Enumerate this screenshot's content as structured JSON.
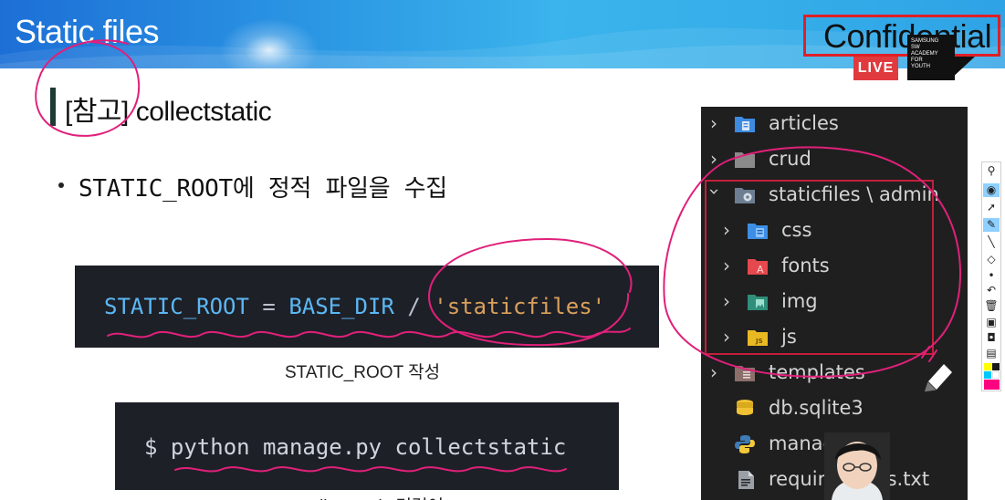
{
  "slide": {
    "title": "Static files",
    "confidential_label": "Confidential",
    "live_badge": "LIVE",
    "logo_text": "SAMSUNG\nSW\nACADEMY\nFOR\nYOUTH",
    "heading": "[참고] collectstatic",
    "bullet": "STATIC_ROOT에 정적 파일을 수집"
  },
  "code_blocks": [
    {
      "tokens": {
        "var1": "STATIC_ROOT",
        "eq": " = ",
        "var2": "BASE_DIR",
        "slash": " / ",
        "str": "'staticfiles'"
      },
      "caption": "STATIC_ROOT 작성"
    },
    {
      "line": "$ python manage.py collectstatic",
      "caption": "collectstatic 명령어"
    }
  ],
  "explorer": {
    "items": [
      {
        "label": "articles",
        "icon": "folder-blue-icon",
        "expanded": false
      },
      {
        "label": "crud",
        "icon": "folder-icon",
        "expanded": false
      },
      {
        "label": "staticfiles \\ admin",
        "icon": "folder-gear-icon",
        "expanded": true
      },
      {
        "label": "css",
        "icon": "folder-css-icon",
        "expanded": false
      },
      {
        "label": "fonts",
        "icon": "folder-fonts-icon",
        "expanded": false
      },
      {
        "label": "img",
        "icon": "folder-img-icon",
        "expanded": false
      },
      {
        "label": "js",
        "icon": "folder-js-icon",
        "expanded": false
      },
      {
        "label": "templates",
        "icon": "folder-templates-icon",
        "expanded": false
      },
      {
        "label": "db.sqlite3",
        "icon": "database-icon"
      },
      {
        "label": "manage.py",
        "icon": "python-icon"
      },
      {
        "label": "requirements.txt",
        "icon": "text-file-icon"
      }
    ]
  },
  "toolbar": {
    "tools": [
      "pin-icon",
      "eye-icon",
      "cursor-icon",
      "pen-icon",
      "line-icon",
      "eraser-icon",
      "dot-icon",
      "undo-icon",
      "trash-icon",
      "whiteboard-icon",
      "camera-icon",
      "clipboard-icon"
    ],
    "swatches": [
      "#ffff00",
      "#1b1b1b",
      "#00c8ff",
      "#ffffff",
      "#ff0080",
      "#ff0080"
    ]
  },
  "colors": {
    "header_start": "#1d6fd6",
    "header_end": "#35aee9",
    "annotation_pink": "#e0207a",
    "annotation_red": "#c21f3a",
    "code_bg": "#1e2027",
    "explorer_bg": "#1f1f1f"
  }
}
